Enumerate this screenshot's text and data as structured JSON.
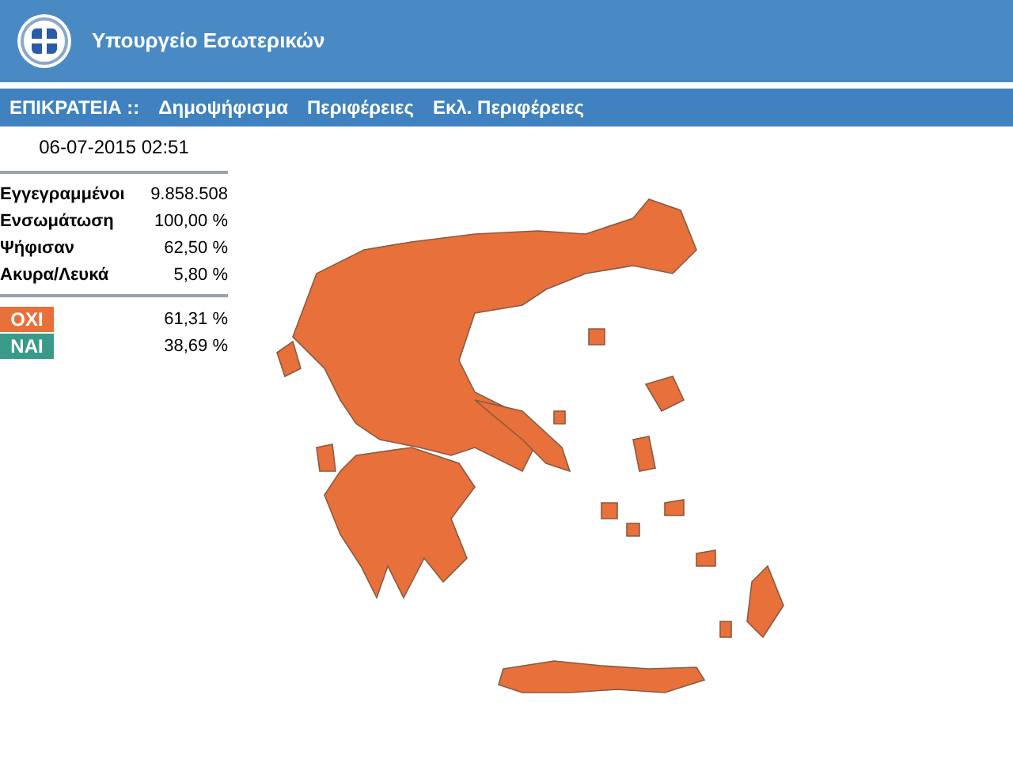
{
  "header": {
    "title": "Υπουργείο Εσωτερικών"
  },
  "nav": [
    {
      "label": "ΕΠΙΚΡΑΤΕΙΑ ::"
    },
    {
      "label": "Δημοψήφισμα"
    },
    {
      "label": "Περιφέρειες"
    },
    {
      "label": "Εκλ. Περιφέρειες"
    }
  ],
  "timestamp": "06-07-2015 02:51",
  "stats": [
    {
      "label": "Εγγεγραμμένοι",
      "value": "9.858.508"
    },
    {
      "label": "Ενσωμάτωση",
      "value": "100,00 %"
    },
    {
      "label": "Ψήφισαν",
      "value": "62,50 %"
    },
    {
      "label": "Ακυρα/Λευκά",
      "value": "5,80 %"
    }
  ],
  "results": [
    {
      "label": "ΟΧΙ",
      "value": "61,31 %",
      "color": "#e8703a"
    },
    {
      "label": "ΝΑΙ",
      "value": "38,69 %",
      "color": "#3a9a8a"
    }
  ],
  "map": {
    "color": "#e8703a"
  }
}
